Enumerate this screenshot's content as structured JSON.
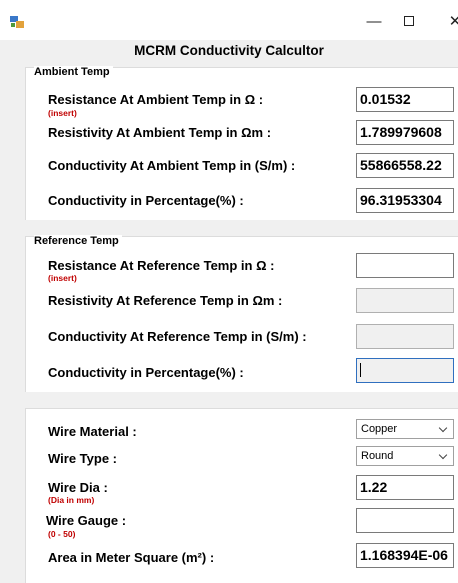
{
  "window": {
    "title": "",
    "minimize_glyph": "—",
    "close_glyph": "✕"
  },
  "app": {
    "heading": "MCRM Conductivity Calcultor"
  },
  "ambient": {
    "group_title": "Ambient Temp",
    "resistance_label": "Resistance At Ambient Temp in Ω :",
    "resistance_hint": "(insert)",
    "resistance_value": "0.01532",
    "resistivity_label": "Resistivity At Ambient Temp in Ωm :",
    "resistivity_value": "1.789979608",
    "conductivity_label": "Conductivity At Ambient Temp in (S/m) :",
    "conductivity_value": "55866558.22",
    "percentage_label": "Conductivity in Percentage(%) :",
    "percentage_value": "96.31953304"
  },
  "reference": {
    "group_title": "Reference Temp",
    "resistance_label": "Resistance At Reference Temp in Ω :",
    "resistance_hint": "(insert)",
    "resistance_value": "",
    "resistivity_label": "Resistivity At Reference Temp in Ωm :",
    "resistivity_value": "",
    "conductivity_label": "Conductivity At Reference Temp in (S/m) :",
    "conductivity_value": "",
    "percentage_label": "Conductivity in Percentage(%) :",
    "percentage_value": ""
  },
  "wire": {
    "material_label": "Wire Material :",
    "material_value": "Copper",
    "type_label": "Wire Type :",
    "type_value": "Round",
    "dia_label": "Wire Dia :",
    "dia_hint": "(Dia in mm)",
    "dia_value": "1.22",
    "gauge_label": "Wire Gauge :",
    "gauge_hint": "(0 - 50)",
    "gauge_value": "",
    "area_label": "Area in Meter Square (m²) :",
    "area_value": "1.168394E-06"
  }
}
